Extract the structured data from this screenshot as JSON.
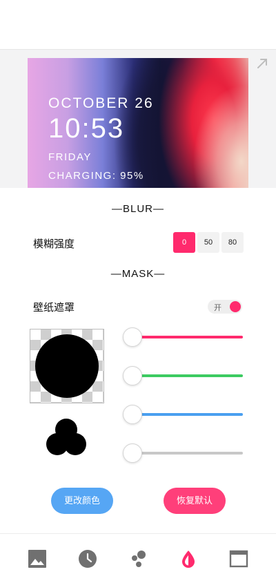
{
  "lockscreen": {
    "date": "OCTOBER 26",
    "time": "10:53",
    "day": "FRIDAY",
    "charging": "CHARGING: 95%"
  },
  "blur": {
    "title": "—BLUR—",
    "label": "模糊强度",
    "options": [
      "0",
      "50",
      "80"
    ],
    "selected": "0"
  },
  "mask": {
    "title": "—MASK—",
    "label": "壁纸遮罩",
    "toggle_label": "开",
    "toggle_on": true,
    "sliders": [
      {
        "color": "#ff2a6d",
        "value": 0
      },
      {
        "color": "#3ccb61",
        "value": 0
      },
      {
        "color": "#4a9ff0",
        "value": 0
      },
      {
        "color": "#c8c8c8",
        "value": 0
      }
    ]
  },
  "actions": {
    "change_color": "更改颜色",
    "restore_default": "恢复默认"
  },
  "colors": {
    "accent": "#ff2a6d",
    "blue_button": "#56a6f4",
    "pink_button": "#ff3f7a"
  },
  "nav": {
    "items": [
      {
        "icon": "image-icon",
        "active": false
      },
      {
        "icon": "clock-icon",
        "active": false
      },
      {
        "icon": "bubbles-icon",
        "active": false
      },
      {
        "icon": "drop-icon",
        "active": true
      },
      {
        "icon": "window-icon",
        "active": false
      }
    ]
  }
}
